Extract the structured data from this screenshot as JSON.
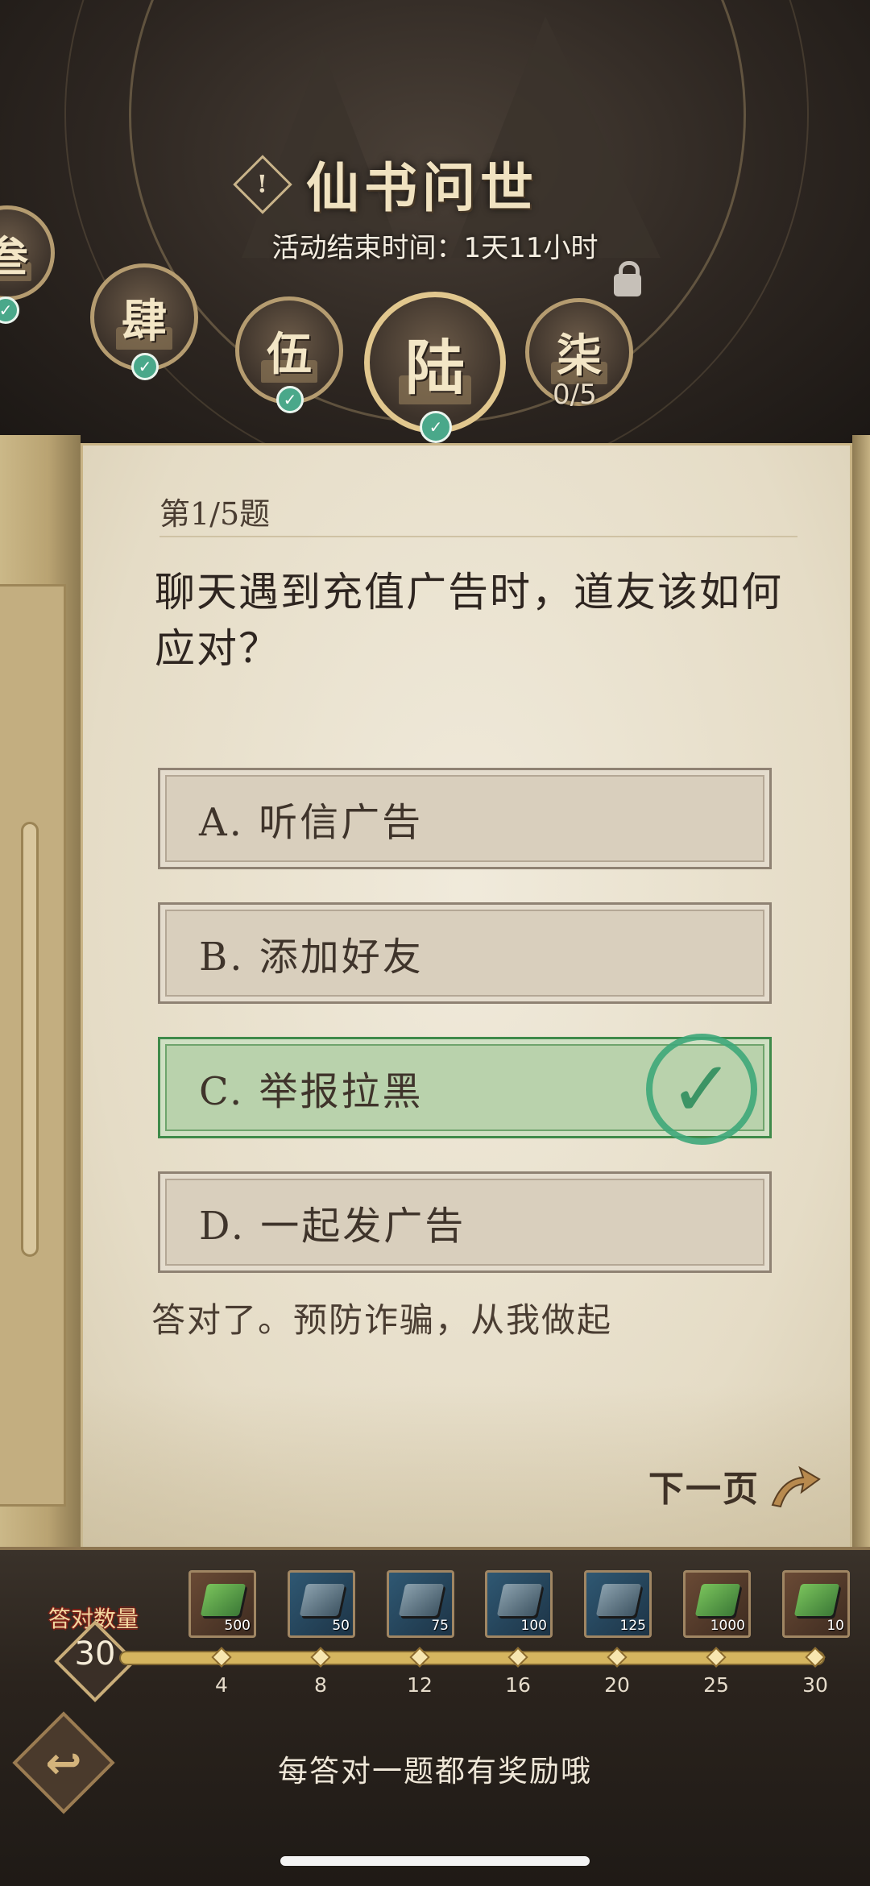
{
  "event": {
    "title": "仙书问世",
    "end_time": "活动结束时间：1天11小时"
  },
  "chapters": [
    {
      "label": "叁",
      "status": "completed"
    },
    {
      "label": "肆",
      "status": "completed"
    },
    {
      "label": "伍",
      "status": "completed"
    },
    {
      "label": "陆",
      "status": "completed",
      "selected": true
    },
    {
      "label": "柒",
      "status": "locked",
      "progress": "0/5"
    }
  ],
  "question": {
    "number": "第1/5题",
    "text": "聊天遇到充值广告时，道友该如何应对？",
    "options": [
      {
        "label": "A. 听信广告",
        "correct": false
      },
      {
        "label": "B. 添加好友",
        "correct": false
      },
      {
        "label": "C. 举报拉黑",
        "correct": true
      },
      {
        "label": "D. 一起发广告",
        "correct": false
      }
    ],
    "feedback": "答对了。预防诈骗，从我做起"
  },
  "next_page_label": "下一页",
  "rewards": {
    "count_label": "答对数量",
    "count_value": "30",
    "milestones": [
      "4",
      "8",
      "12",
      "16",
      "20",
      "25",
      "30"
    ],
    "items": [
      {
        "qty": "500",
        "style": "gold"
      },
      {
        "qty": "50",
        "style": "blue"
      },
      {
        "qty": "75",
        "style": "blue"
      },
      {
        "qty": "100",
        "style": "blue"
      },
      {
        "qty": "125",
        "style": "blue"
      },
      {
        "qty": "1000",
        "style": "gold"
      },
      {
        "qty": "10",
        "style": "gold"
      }
    ]
  },
  "bottom_hint": "每答对一题都有奖励哦",
  "colors": {
    "correct_green": "#3fa87a",
    "paper": "#e5dcc6",
    "frame_gold": "#c9b486"
  }
}
